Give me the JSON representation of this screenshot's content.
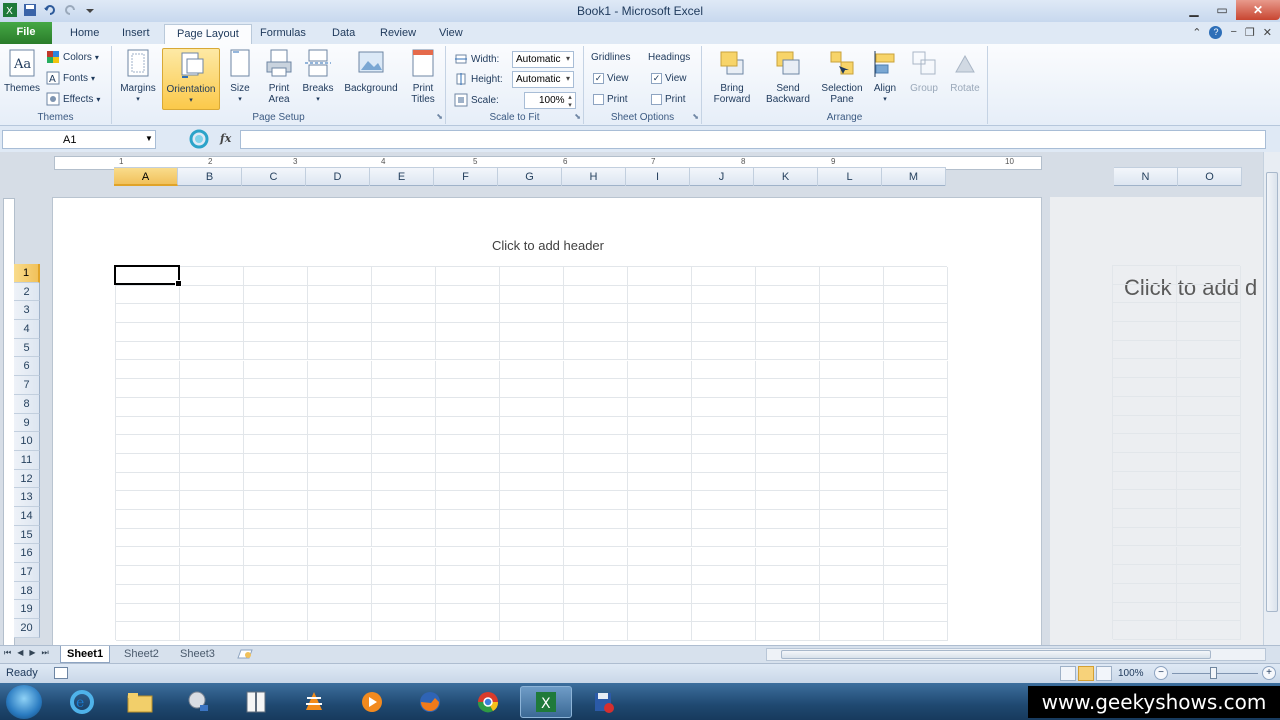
{
  "window": {
    "title": "Book1 - Microsoft Excel"
  },
  "ribbon_tabs": [
    {
      "label": "File"
    },
    {
      "label": "Home"
    },
    {
      "label": "Insert"
    },
    {
      "label": "Page Layout"
    },
    {
      "label": "Formulas"
    },
    {
      "label": "Data"
    },
    {
      "label": "Review"
    },
    {
      "label": "View"
    }
  ],
  "ribbon": {
    "themes": {
      "group_label": "Themes",
      "themes_label": "Themes",
      "colors_label": "Colors",
      "fonts_label": "Fonts",
      "effects_label": "Effects"
    },
    "page_setup": {
      "group_label": "Page Setup",
      "margins": "Margins",
      "orientation": "Orientation",
      "size": "Size",
      "print_area_1": "Print",
      "print_area_2": "Area",
      "breaks": "Breaks",
      "background": "Background",
      "print_titles_1": "Print",
      "print_titles_2": "Titles"
    },
    "scale_to_fit": {
      "group_label": "Scale to Fit",
      "width_label": "Width:",
      "width_value": "Automatic",
      "height_label": "Height:",
      "height_value": "Automatic",
      "scale_label": "Scale:",
      "scale_value": "100%"
    },
    "sheet_options": {
      "group_label": "Sheet Options",
      "gridlines": "Gridlines",
      "headings": "Headings",
      "view": "View",
      "print": "Print",
      "check": "✓"
    },
    "arrange": {
      "group_label": "Arrange",
      "bring_forward_1": "Bring",
      "bring_forward_2": "Forward",
      "send_backward_1": "Send",
      "send_backward_2": "Backward",
      "selection_pane_1": "Selection",
      "selection_pane_2": "Pane",
      "align": "Align",
      "group": "Group",
      "rotate": "Rotate"
    }
  },
  "formula_bar": {
    "name_box": "A1",
    "fx": "fx",
    "formula": ""
  },
  "ruler_numbers": [
    "1",
    "2",
    "3",
    "4",
    "5",
    "6",
    "7",
    "8",
    "9",
    "10"
  ],
  "columns": [
    "A",
    "B",
    "C",
    "D",
    "E",
    "F",
    "G",
    "H",
    "I",
    "J",
    "K",
    "L",
    "M"
  ],
  "columns_page2": [
    "N",
    "O"
  ],
  "rows": [
    "1",
    "2",
    "3",
    "4",
    "5",
    "6",
    "7",
    "8",
    "9",
    "10",
    "11",
    "12",
    "13",
    "14",
    "15",
    "16",
    "17",
    "18",
    "19",
    "20"
  ],
  "page": {
    "header_hint": "Click to add header",
    "header_hint_page2": "Click to add d"
  },
  "sheets": [
    "Sheet1",
    "Sheet2",
    "Sheet3"
  ],
  "status": {
    "ready": "Ready",
    "zoom": "100%",
    "zoom_minus": "−",
    "zoom_plus": "+"
  },
  "watermark": "www.geekyshows.com",
  "colors": {
    "file_tab": "#2a7c2a",
    "selection": "#f1c15b",
    "taskbar": "#1f4870"
  }
}
